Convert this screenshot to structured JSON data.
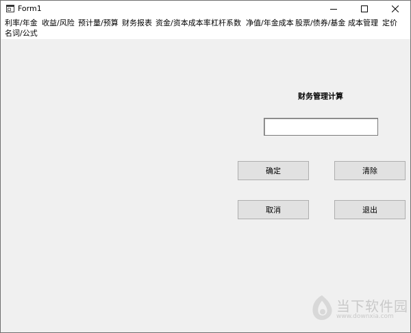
{
  "window": {
    "title": "Form1",
    "controls": {
      "minimize": "minimize",
      "maximize": "maximize",
      "close": "close"
    }
  },
  "menu": {
    "items": [
      "利率/年金",
      "收益/风险",
      "预计量/预算",
      "财务报表",
      "资金/资本成本率",
      "杠杆系数",
      "净值/年金成本",
      "股票/债券/基金",
      "成本管理",
      "定价",
      "名词/公式"
    ]
  },
  "form": {
    "heading": "财务管理计算",
    "input_value": "",
    "buttons": {
      "ok": "确定",
      "clear": "清除",
      "cancel": "取消",
      "exit": "退出"
    }
  },
  "watermark": {
    "site_name": "当下软件园",
    "url": "www.downxia.com"
  },
  "colors": {
    "window_bg": "#f0f0f0",
    "titlebar_bg": "#ffffff",
    "button_bg": "#e1e1e1",
    "button_border": "#adadad",
    "watermark": "#c9c9c9"
  }
}
